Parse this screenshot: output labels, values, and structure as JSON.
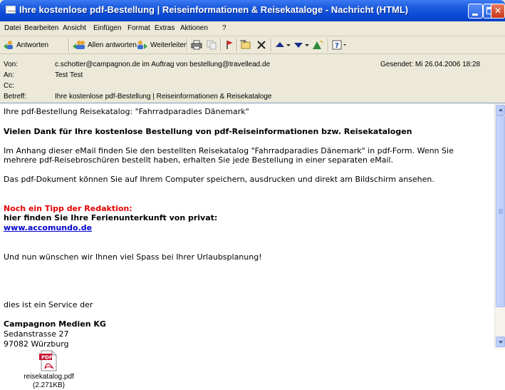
{
  "window": {
    "title": "Ihre kostenlose pdf-Bestellung | Reiseinformationen & Reisekataloge - Nachricht (HTML)"
  },
  "menu": [
    "Datei",
    "Bearbeiten",
    "Ansicht",
    "Einfügen",
    "Format",
    "Extras",
    "Aktionen",
    "?"
  ],
  "toolbar": {
    "reply_label": "Antworten",
    "reply_all_label": "Allen antworten",
    "forward_label": "Weiterleiten"
  },
  "header": {
    "from_label": "Von:",
    "from_value": "c.schotter@campagnon.de im Auftrag von bestellung@travellead.de",
    "to_label": "An:",
    "to_value": "Test Test",
    "cc_label": "Cc:",
    "cc_value": "",
    "subject_label": "Betreff:",
    "subject_value": "Ihre kostenlose pdf-Bestellung | Reiseinformationen & Reisekataloge",
    "sent": "Gesendet: Mi 26.04.2006 18:28"
  },
  "message": {
    "line1": "Ihre pdf-Bestellung Reisekatalog: \"Fahrradparadies Dänemark\"",
    "heading": "Vielen Dank für Ihre kostenlose Bestellung von pdf-Reiseinformationen bzw. Reisekatalogen",
    "para1_line1": "Im Anhang dieser eMail finden Sie den bestellten Reisekatalog \"Fahrradparadies Dänemark\" in pdf-Form. Wenn Sie",
    "para1_line2": "mehrere pdf-Reisebroschüren bestellt haben, erhalten Sie jede Bestellung in einer separaten eMail.",
    "para2": "Das pdf-Dokument können Sie auf Ihrem Computer speichern, ausdrucken und direkt am Bildschirm ansehen.",
    "tip_title": "Noch ein Tipp der Redaktion:",
    "tip_text": "hier finden Sie Ihre Ferienunterkunft von privat:",
    "tip_link": "www.accomundo.de",
    "closing": "Und nun wünschen wir Ihnen viel Spass bei Ihrer Urlaubsplanung!",
    "service": "dies ist ein Service der",
    "company": "Campagnon Medien KG",
    "street": "Sedanstrasse 27",
    "city": "97082 Würzburg"
  },
  "attachment": {
    "filename": "reisekatalog.pdf",
    "size": "(2.271KB)",
    "icon_text": "PDF"
  }
}
